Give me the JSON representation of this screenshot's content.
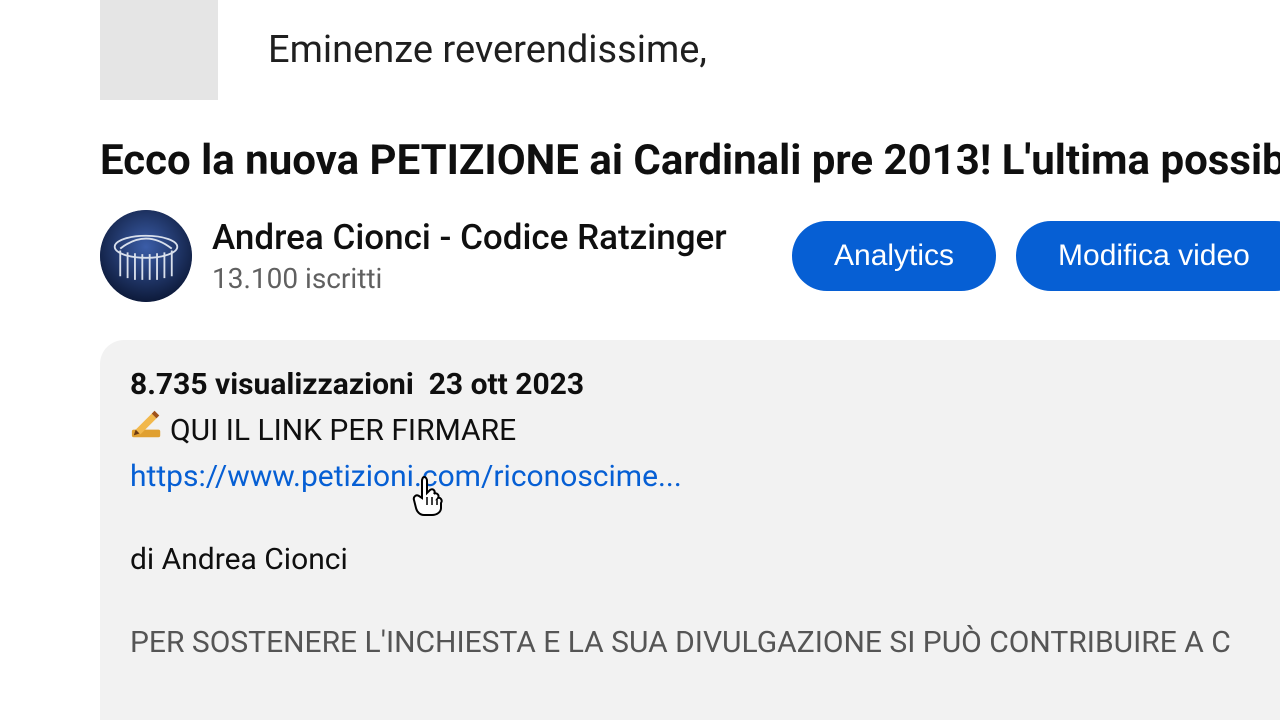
{
  "thumb": {
    "greeting": "Eminenze reverendissime,"
  },
  "video": {
    "title": "Ecco la nuova PETIZIONE ai Cardinali pre 2013! L'ultima possib"
  },
  "channel": {
    "name": "Andrea Cionci - Codice Ratzinger",
    "subs_label": "13.100 iscritti"
  },
  "buttons": {
    "analytics": "Analytics",
    "edit_video": "Modifica video"
  },
  "description": {
    "views_label": "8.735 visualizzazioni",
    "date": "23 ott 2023",
    "sign_label": "QUI IL LINK PER FIRMARE",
    "petition_link_text": "https://www.petizioni.com/riconoscime...",
    "author_line": "di Andrea Cionci",
    "support_line": "PER SOSTENERE L'INCHIESTA E LA SUA DIVULGAZIONE SI PUÒ CONTRIBUIRE A C"
  }
}
